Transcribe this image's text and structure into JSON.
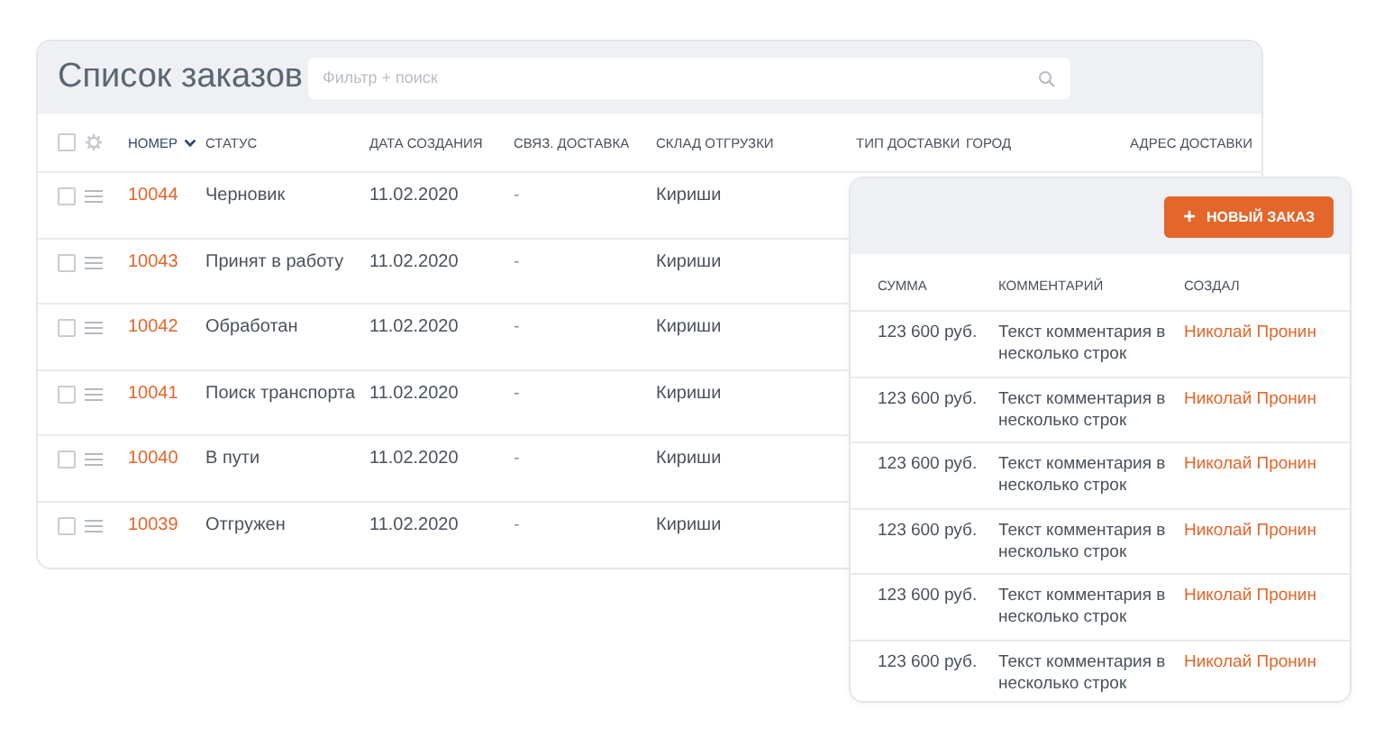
{
  "title": "Список заказов",
  "search": {
    "placeholder": "Фильтр + поиск"
  },
  "header_checkbox": {
    "checked": false
  },
  "columns": [
    {
      "label": "НОМЕР",
      "sorted": true
    },
    {
      "label": "СТАТУС",
      "sorted": false
    },
    {
      "label": "ДАТА СОЗДАНИЯ",
      "sorted": false
    },
    {
      "label": "СВЯЗ. ДОСТАВКА",
      "sorted": false
    },
    {
      "label": "СКЛАД ОТГРУЗКИ",
      "sorted": false
    },
    {
      "label": "ТИП ДОСТАВКИ",
      "sorted": false
    },
    {
      "label": "ГОРОД",
      "sorted": false
    },
    {
      "label": "АДРЕС ДОСТАВКИ",
      "sorted": false
    }
  ],
  "rows": [
    {
      "checked": false,
      "number": "10044",
      "status": "Черновик",
      "date": "11.02.2020",
      "linked": "-",
      "warehouse": "Кириши"
    },
    {
      "checked": false,
      "number": "10043",
      "status": "Принят в работу",
      "date": "11.02.2020",
      "linked": "-",
      "warehouse": "Кириши"
    },
    {
      "checked": false,
      "number": "10042",
      "status": "Обработан",
      "date": "11.02.2020",
      "linked": "-",
      "warehouse": "Кириши"
    },
    {
      "checked": false,
      "number": "10041",
      "status": "Поиск транспорта",
      "date": "11.02.2020",
      "linked": "-",
      "warehouse": "Кириши"
    },
    {
      "checked": false,
      "number": "10040",
      "status": "В пути",
      "date": "11.02.2020",
      "linked": "-",
      "warehouse": "Кириши"
    },
    {
      "checked": false,
      "number": "10039",
      "status": "Отгружен",
      "date": "11.02.2020",
      "linked": "-",
      "warehouse": "Кириши"
    }
  ],
  "panel": {
    "button": {
      "icon": "+",
      "label": "НОВЫЙ ЗАКАЗ"
    },
    "columns": [
      "СУММА",
      "КОММЕНТАРИЙ",
      "СОЗДАЛ"
    ],
    "rows": [
      {
        "sum": "123 600 руб.",
        "comment": "Текст комментария в несколько строк",
        "author": "Николай Пронин"
      },
      {
        "sum": "123 600 руб.",
        "comment": "Текст комментария в несколько строк",
        "author": "Николай Пронин"
      },
      {
        "sum": "123 600 руб.",
        "comment": "Текст комментария в несколько строк",
        "author": "Николай Пронин"
      },
      {
        "sum": "123 600 руб.",
        "comment": "Текст комментария в несколько строк",
        "author": "Николай Пронин"
      },
      {
        "sum": "123 600 руб.",
        "comment": "Текст комментария в несколько строк",
        "author": "Николай Пронин"
      },
      {
        "sum": "123 600 руб.",
        "comment": "Текст комментария в несколько строк",
        "author": "Николай Пронин"
      }
    ]
  }
}
